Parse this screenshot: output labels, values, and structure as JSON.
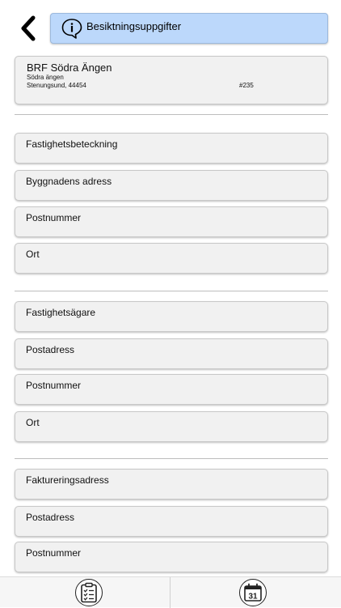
{
  "header": {
    "title": "Besiktningsuppgifter",
    "back_icon": "chevron-left-icon",
    "info_icon": "info-speech-bubble-icon",
    "accent_color": "#bcd8fb"
  },
  "property": {
    "name": "BRF Södra Ängen",
    "street": "Södra ängen",
    "city": "Stenungsund, 44454",
    "number": "#235"
  },
  "sections": [
    {
      "fields": [
        {
          "label": "Fastighetsbeteckning"
        },
        {
          "label": "Byggnadens adress"
        },
        {
          "label": "Postnummer"
        },
        {
          "label": "Ort"
        }
      ]
    },
    {
      "fields": [
        {
          "label": "Fastighetsägare"
        },
        {
          "label": "Postadress"
        },
        {
          "label": "Postnummer"
        },
        {
          "label": "Ort"
        }
      ]
    },
    {
      "fields": [
        {
          "label": "Faktureringsadress"
        },
        {
          "label": "Postadress"
        },
        {
          "label": "Postnummer"
        }
      ]
    }
  ],
  "bottom_nav": {
    "left_icon": "checklist-icon",
    "right_icon": "calendar-icon",
    "calendar_day": "31"
  }
}
